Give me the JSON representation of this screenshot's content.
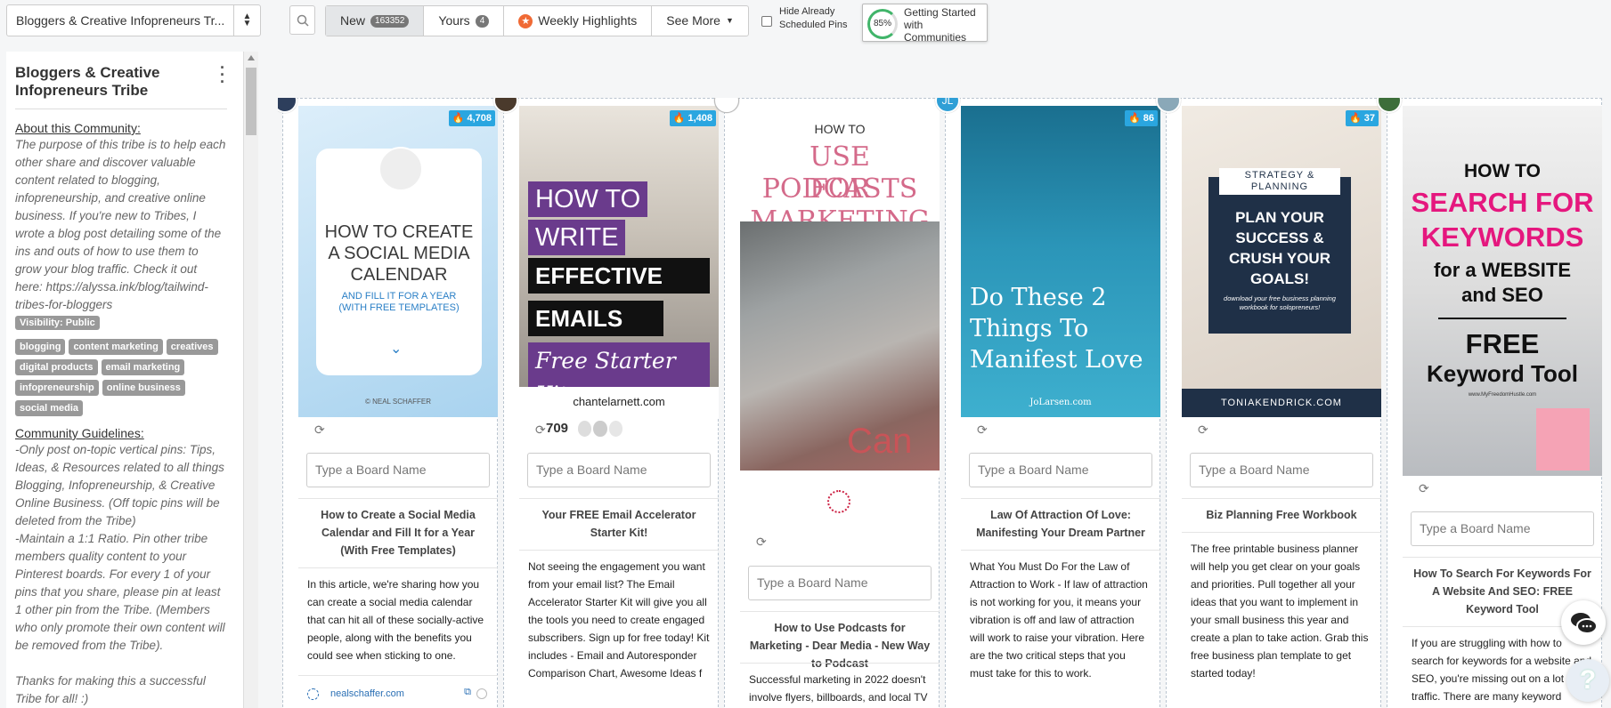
{
  "topbar": {
    "tribe_select": "Bloggers & Creative Infopreneurs Tr...",
    "tabs": [
      {
        "label": "New",
        "count": "163352"
      },
      {
        "label": "Yours",
        "count": "4"
      },
      {
        "label": "Weekly Highlights"
      },
      {
        "label": "See More"
      }
    ],
    "hide_scheduled_line1": "Hide Already",
    "hide_scheduled_line2": "Scheduled Pins",
    "getting_started_pct": "85%",
    "getting_started_label": "Getting Started with Communities"
  },
  "sidebar": {
    "title": "Bloggers & Creative Infopreneurs Tribe",
    "about_heading": "About this Community:",
    "about_text": "The purpose of this tribe is to help each other share and discover valuable content related to blogging, infopreneurship, and creative online business. If you're new to Tribes, I wrote a blog post detailing some of the ins and outs of how to use them to grow your blog traffic. Check it out here: https://alyssa.ink/blog/tailwind-tribes-for-bloggers",
    "visibility": "Visibility: Public",
    "tags": [
      "blogging",
      "content marketing",
      "creatives",
      "digital products",
      "email marketing",
      "infopreneurship",
      "online business",
      "social media"
    ],
    "guidelines_heading": "Community Guidelines:",
    "guidelines_text": "-Only post on-topic vertical pins: Tips, Ideas, & Resources related to all things Blogging, Infopreneurship, & Creative Online Business. (Off topic pins will be deleted from the Tribe)\n-Maintain a 1:1 Ratio. Pin other tribe members quality content to your Pinterest boards. For every 1 of your pins that you share, please pin at least 1 other pin from the Tribe. (Members who only promote their own content will be removed from the Tribe).",
    "thanks_text": "Thanks for making this a successful Tribe for all! :)"
  },
  "board_placeholder": "Type a Board Name",
  "cards": [
    {
      "flame": "4,708",
      "image_lines": [
        "HOW TO CREATE",
        "A SOCIAL MEDIA",
        "CALENDAR"
      ],
      "image_sub": "AND FILL IT FOR A YEAR (WITH FREE TEMPLATES)",
      "image_footer": "NEAL SCHAFFER",
      "title": "How to Create a Social Media Calendar and Fill It for a Year (With Free Templates)",
      "description": "In this article, we're sharing how you can create a social media calendar that can hit all of these socially-active people, along with the benefits you could see when sticking to one.",
      "source": "nealschaffer.com"
    },
    {
      "flame": "1,408",
      "image_lines": [
        "HOW TO",
        "WRITE",
        "EFFECTIVE",
        "EMAILS"
      ],
      "image_sub": "Free Starter Kit",
      "image_footer": "chantelarnett.com",
      "repin_count": "709",
      "title": "Your FREE Email Accelerator Starter Kit!",
      "description": "Not seeing the engagement you want from your email list? The Email Accelerator Starter Kit will give you all the tools you need to create engaged subscribers. Sign up for free today! Kit includes - Email and Autoresponder Comparison Chart, Awesome Ideas f"
    },
    {
      "image_lines": [
        "HOW TO",
        "USE PODCASTS",
        "FOR MARKETING"
      ],
      "image_footer": "Can",
      "title": "How to Use Podcasts for Marketing - Dear Media - New Way to Podcast",
      "description": "Successful marketing in 2022 doesn't involve flyers, billboards, and local TV"
    },
    {
      "flame": "86",
      "image_lines": [
        "Do These 2",
        "Things To",
        "Manifest Love"
      ],
      "image_footer": "JoLarsen.com",
      "title": "Law Of Attraction Of Love: Manifesting Your Dream Partner",
      "description": "What You Must Do For the Law of Attraction to Work - If law of attraction is not working for you, it means your vibration is off and law of attraction will work to raise your vibration. Here are the two critical steps that you must take for this to work."
    },
    {
      "flame": "37",
      "image_lines": [
        "STRATEGY &",
        "PLANNING",
        "PLAN YOUR",
        "SUCCESS &",
        "CRUSH YOUR",
        "GOALS!"
      ],
      "image_sub": "download your free business planning workbook for solopreneurs!",
      "image_footer": "TONIAKENDRICK.COM",
      "title": "Biz Planning Free Workbook",
      "description": "The free printable business planner will help you get clear on your goals and priorities. Pull together all your ideas that you want to implement in your small business this year and create a plan to take action. Grab this free business plan template to get started today!"
    },
    {
      "image_lines": [
        "HOW TO",
        "SEARCH FOR",
        "KEYWORDS",
        "for a WEBSITE",
        "and SEO",
        "FREE",
        "Keyword Tool"
      ],
      "image_footer": "www.MyFreedomHustle.com",
      "title": "How To Search For Keywords For A Website And SEO: FREE Keyword Tool",
      "description": "If you are struggling with how to search for keywords for a website and SEO, you're missing out on a lot of traffic. There are many keyword"
    }
  ]
}
